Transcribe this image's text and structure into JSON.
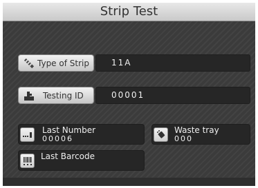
{
  "header": {
    "title": "Strip Test"
  },
  "strip_type": {
    "label": "Type of Strip",
    "value": "11A"
  },
  "testing_id": {
    "label": "Testing ID",
    "value": "00001"
  },
  "last_number": {
    "label": "Last Number",
    "value": "00006"
  },
  "waste_tray": {
    "label": "Waste tray",
    "value": "000"
  },
  "last_barcode": {
    "label": "Last Barcode",
    "value": ""
  },
  "icons": {
    "strip_type": "test-strip-icon",
    "testing_id": "id-icon",
    "last_number": "counter-icon",
    "waste_tray": "waste-tray-icon",
    "last_barcode": "barcode-icon"
  }
}
